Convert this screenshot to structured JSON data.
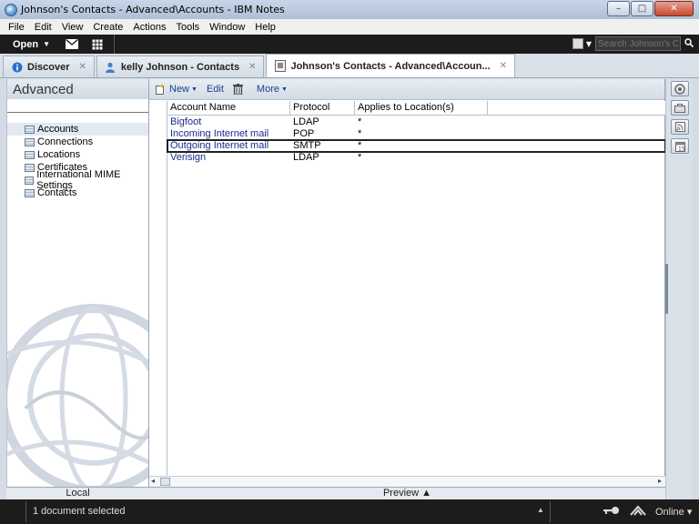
{
  "window": {
    "title": "Johnson's Contacts - Advanced\\Accounts - IBM Notes",
    "controls": {
      "minimize": "–",
      "maximize": "□",
      "close": "✕"
    }
  },
  "menu": [
    {
      "label": "File"
    },
    {
      "label": "Edit"
    },
    {
      "label": "View"
    },
    {
      "label": "Create"
    },
    {
      "label": "Actions"
    },
    {
      "label": "Tools"
    },
    {
      "label": "Window"
    },
    {
      "label": "Help"
    }
  ],
  "toolbar": {
    "open_label": "Open",
    "search_placeholder": "Search Johnson's Cor"
  },
  "tabs": [
    {
      "label": "Discover",
      "icon": "info-icon",
      "close": "✕"
    },
    {
      "label": "kelly Johnson - Contacts",
      "icon": "person-icon",
      "close": "✕"
    },
    {
      "label": "Johnson's Contacts - Advanced\\Accoun...",
      "icon": "database-icon",
      "close": "✕"
    }
  ],
  "nav": {
    "heading": "Advanced",
    "items": [
      {
        "label": "Accounts"
      },
      {
        "label": "Connections"
      },
      {
        "label": "Locations"
      },
      {
        "label": "Certificates"
      },
      {
        "label": "International MIME Settings"
      },
      {
        "label": "Contacts"
      }
    ],
    "footer": "Local"
  },
  "actions": {
    "new_label": "New",
    "edit_label": "Edit",
    "more_label": "More"
  },
  "table": {
    "columns": [
      "Account Name",
      "Protocol",
      "Applies to Location(s)"
    ],
    "rows": [
      {
        "name": "Bigfoot",
        "protocol": "LDAP",
        "location": "*"
      },
      {
        "name": "Incoming Internet mail",
        "protocol": "POP",
        "location": "*"
      },
      {
        "name": "Outgoing Internet mail",
        "protocol": "SMTP",
        "location": "*"
      },
      {
        "name": "Verisign",
        "protocol": "LDAP",
        "location": "*"
      }
    ]
  },
  "preview": {
    "label": "Preview ▲"
  },
  "status": {
    "text": "1 document selected",
    "online": "Online ▾"
  }
}
